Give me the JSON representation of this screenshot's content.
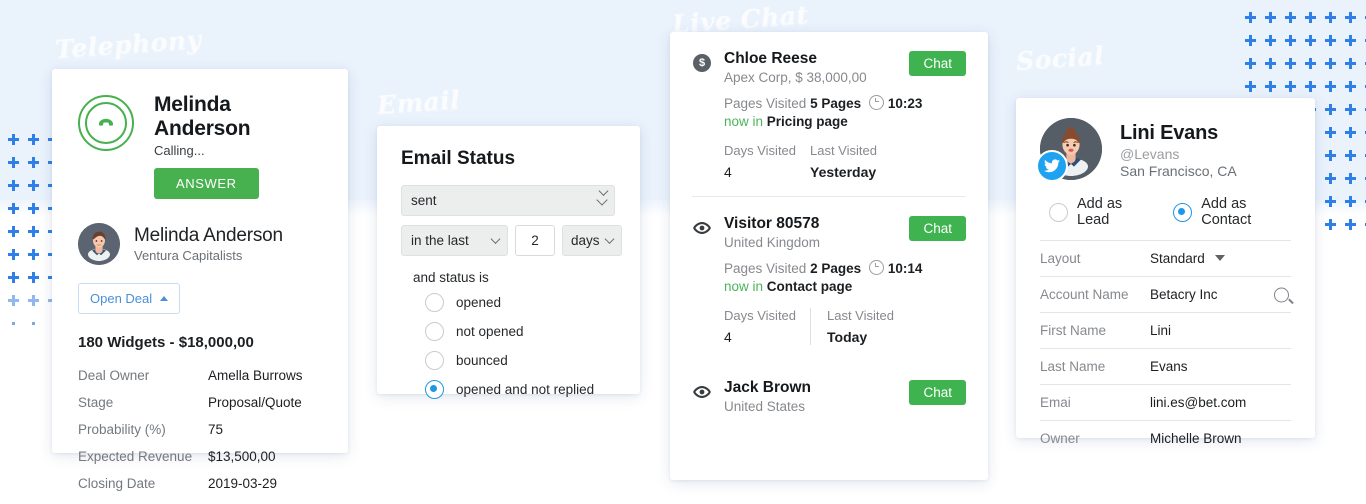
{
  "background": {
    "band_color": "#eaf2fc",
    "plus_color": "#2f7fe8"
  },
  "sections": {
    "telephony_label": "Telephony",
    "email_label": "Email",
    "livechat_label": "Live Chat",
    "social_label": "Social"
  },
  "telephony": {
    "phone_icon": "phone-handset-icon",
    "caller_name": "Melinda Anderson",
    "call_status": "Calling...",
    "answer_button": "ANSWER",
    "contact_name": "Melinda Anderson",
    "contact_company": "Ventura Capitalists",
    "open_deal_button": "Open Deal",
    "deal_title": "180 Widgets - $18,000,00",
    "deal_fields": [
      {
        "label": "Deal Owner",
        "value": "Amella Burrows"
      },
      {
        "label": "Stage",
        "value": "Proposal/Quote"
      },
      {
        "label": "Probability (%)",
        "value": "75"
      },
      {
        "label": "Expected Revenue",
        "value": "$13,500,00"
      },
      {
        "label": "Closing Date",
        "value": "2019-03-29"
      }
    ]
  },
  "email": {
    "title": "Email Status",
    "status_select": "sent",
    "when_select": "in the last",
    "amount_value": "2",
    "unit_select": "days",
    "and_status_is": "and status is",
    "options": [
      {
        "label": "opened",
        "selected": false
      },
      {
        "label": "not opened",
        "selected": false
      },
      {
        "label": "bounced",
        "selected": false
      },
      {
        "label": "opened and not replied",
        "selected": true
      }
    ]
  },
  "livechat": {
    "chat_button": "Chat",
    "pages_visited_label": "Pages Visited",
    "now_in_label": "now in",
    "days_visited_label": "Days Visited",
    "last_visited_label": "Last Visited",
    "items": [
      {
        "icon": "dollar-badge-icon",
        "name": "Chloe Reese",
        "sub": "Apex Corp, $ 38,000,00",
        "pages": "5 Pages",
        "time": "10:23",
        "now_in_page": "Pricing page",
        "days_visited": "4",
        "last_visited": "Yesterday",
        "has_stats": true,
        "divider": false
      },
      {
        "icon": "eye-icon",
        "name": "Visitor 80578",
        "sub": "United Kingdom",
        "pages": "2 Pages",
        "time": "10:14",
        "now_in_page": "Contact page",
        "days_visited": "4",
        "last_visited": "Today",
        "has_stats": true,
        "divider": true
      },
      {
        "icon": "eye-icon",
        "name": "Jack Brown",
        "sub": "United States",
        "has_stats": false
      }
    ]
  },
  "social": {
    "avatar": "user-avatar",
    "network_badge": "twitter-icon",
    "name": "Lini Evans",
    "handle": "@Levans",
    "location": "San Francisco, CA",
    "radios": [
      {
        "label": "Add as Lead",
        "selected": false
      },
      {
        "label": "Add as Contact",
        "selected": true
      }
    ],
    "fields": [
      {
        "label": "Layout",
        "value": "Standard",
        "control": "caret"
      },
      {
        "label": "Account Name",
        "value": "Betacry Inc",
        "control": "search"
      },
      {
        "label": "First Name",
        "value": "Lini",
        "control": "none"
      },
      {
        "label": "Last Name",
        "value": "Evans",
        "control": "none"
      },
      {
        "label": "Emai",
        "value": "lini.es@bet.com",
        "control": "none"
      },
      {
        "label": "Owner",
        "value": "Michelle Brown",
        "control": "none"
      }
    ]
  }
}
